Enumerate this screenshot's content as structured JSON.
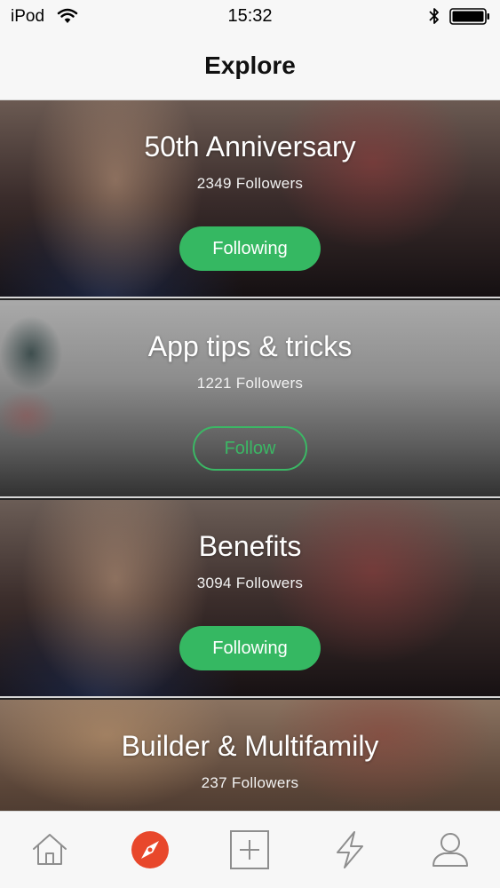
{
  "status_bar": {
    "carrier": "iPod",
    "time": "15:32"
  },
  "nav": {
    "title": "Explore"
  },
  "cards": [
    {
      "title": "50th Anniversary",
      "followers": "2349 Followers",
      "button": "Following",
      "state": "following"
    },
    {
      "title": "App tips & tricks",
      "followers": "1221 Followers",
      "button": "Follow",
      "state": "not-following"
    },
    {
      "title": "Benefits",
      "followers": "3094 Followers",
      "button": "Following",
      "state": "following"
    },
    {
      "title": "Builder & Multifamily",
      "followers": "237 Followers",
      "button": "",
      "state": ""
    }
  ],
  "tab_bar": {
    "tabs": [
      {
        "icon": "home-icon",
        "selected": false
      },
      {
        "icon": "compass-icon",
        "selected": true
      },
      {
        "icon": "add-square-icon",
        "selected": false
      },
      {
        "icon": "lightning-icon",
        "selected": false
      },
      {
        "icon": "profile-icon",
        "selected": false
      }
    ]
  },
  "colors": {
    "accent_green": "#35b862",
    "explore_red": "#e8472b",
    "icon_gray": "#8e8e8e"
  }
}
